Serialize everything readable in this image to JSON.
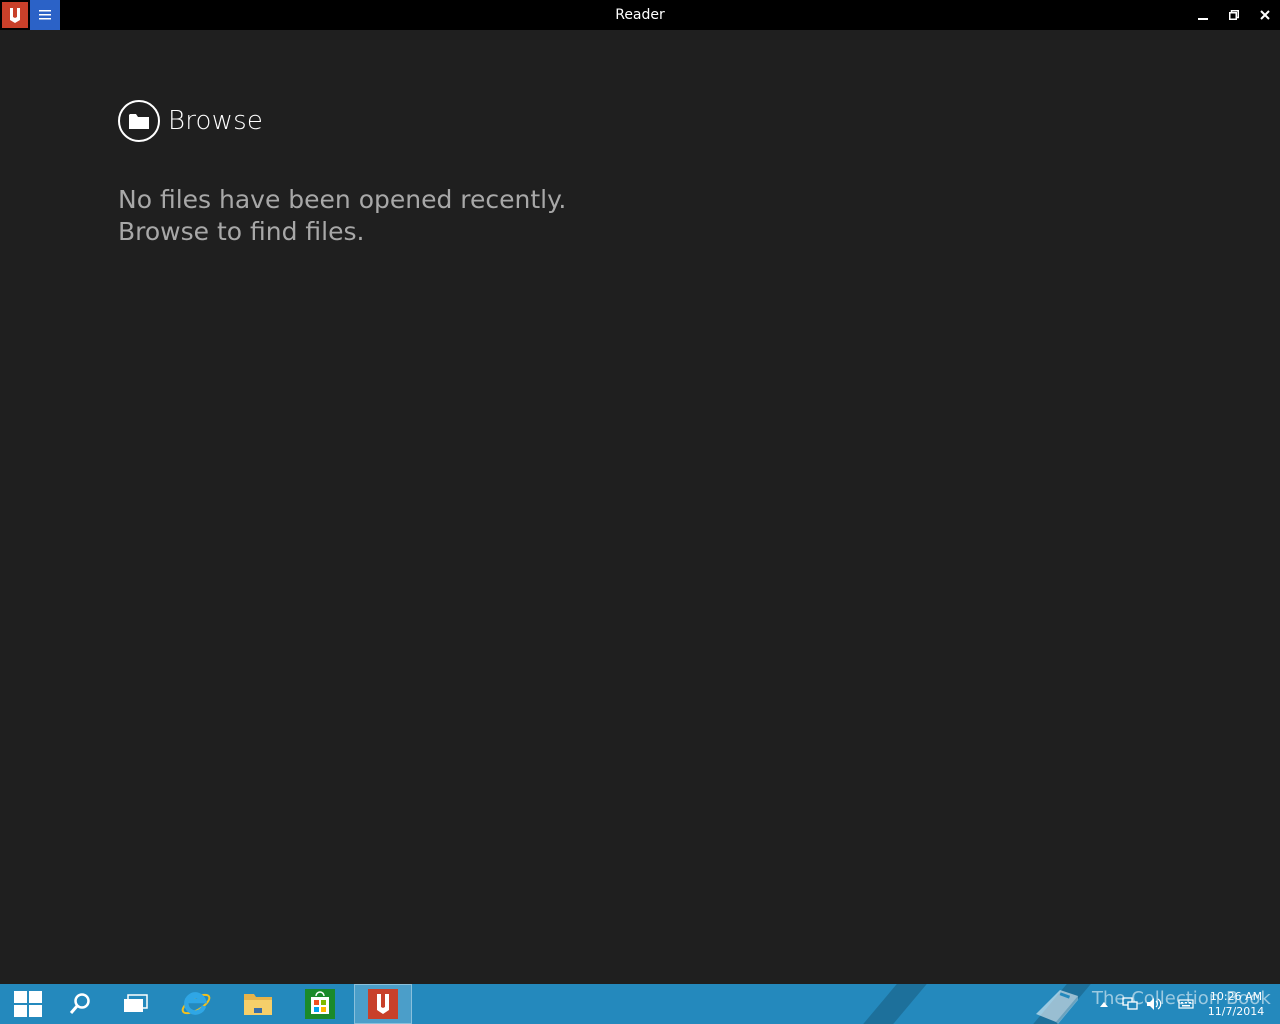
{
  "window": {
    "title": "Reader",
    "controls": {
      "minimize": "minimize",
      "maximize": "restore",
      "close": "close"
    }
  },
  "content": {
    "browse_label": "Browse",
    "empty_line1": "No files have been opened recently.",
    "empty_line2": "Browse to find files."
  },
  "taskbar": {
    "items": [
      {
        "name": "start",
        "icon": "windows-logo-icon"
      },
      {
        "name": "search",
        "icon": "search-icon"
      },
      {
        "name": "task-view",
        "icon": "task-view-icon"
      },
      {
        "name": "internet-explorer",
        "icon": "ie-icon"
      },
      {
        "name": "file-explorer",
        "icon": "folder-icon"
      },
      {
        "name": "store",
        "icon": "store-icon"
      },
      {
        "name": "reader",
        "icon": "reader-icon",
        "active": true
      }
    ],
    "watermark": "The Collection Book",
    "clock": {
      "time": "10:26 AM",
      "date": "11/7/2014"
    }
  },
  "colors": {
    "background": "#1f1f1f",
    "titlebar": "#000000",
    "app_icon": "#c8402a",
    "menu_button": "#2b62c7",
    "taskbar": "#2489bd",
    "empty_text": "#a8a8a8"
  }
}
